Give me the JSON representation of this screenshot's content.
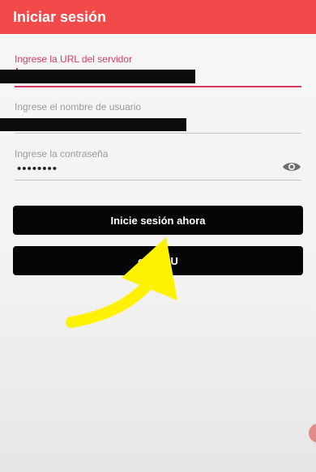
{
  "appbar": {
    "title": "Iniciar sesión"
  },
  "form": {
    "server_url": {
      "label": "Ingrese la URL del servidor",
      "value": ""
    },
    "username": {
      "label": "Ingrese el nombre de usuario",
      "value": ""
    },
    "password": {
      "label": "Ingrese la contraseña",
      "value": "••••••••"
    }
  },
  "buttons": {
    "login": "Inicie sesión ahora",
    "m3u": "enl   M3U"
  },
  "colors": {
    "appbar": "#f24a4a",
    "accent": "#d83a5e",
    "button": "#050505",
    "arrow": "#fff200"
  },
  "icons": {
    "password_toggle": "eye-icon"
  }
}
